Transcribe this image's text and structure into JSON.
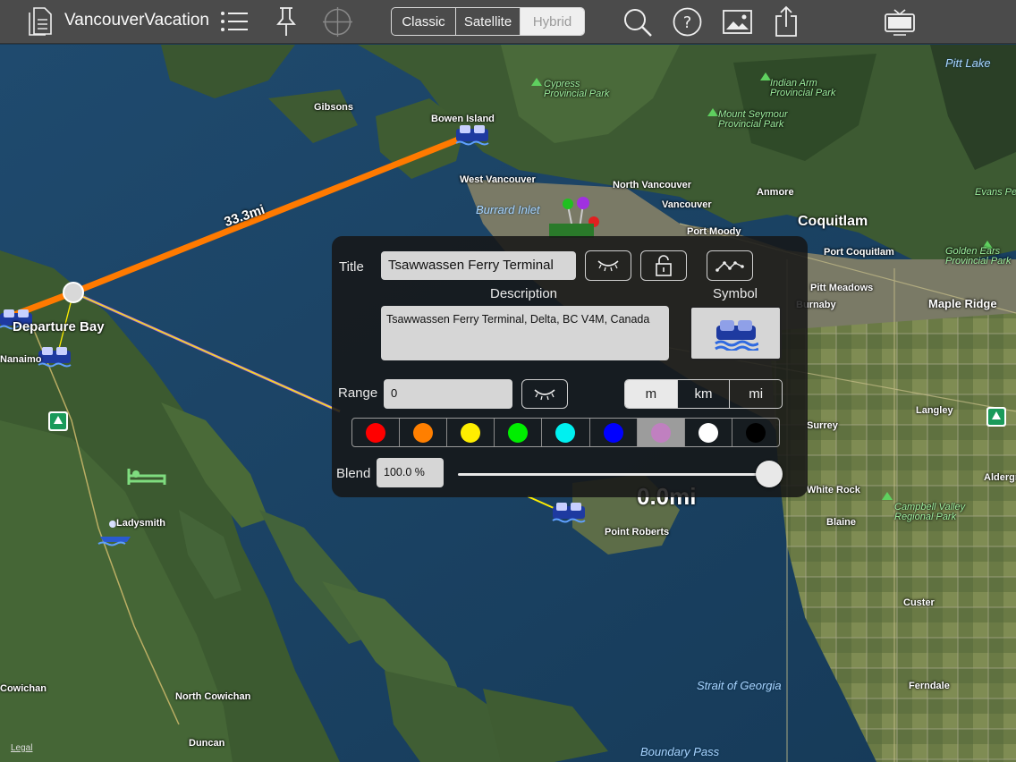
{
  "toolbar": {
    "title": "VancouverVacation",
    "map_types": [
      "Classic",
      "Satellite",
      "Hybrid"
    ],
    "selected_map_type": "Hybrid"
  },
  "map": {
    "distance_long": "33.3mi",
    "distance_short": "0.0mi",
    "legal": "Legal",
    "places": {
      "gibsons": "Gibsons",
      "bowen_island": "Bowen Island",
      "west_vancouver": "West Vancouver",
      "north_vancouver": "North Vancouver",
      "vancouver": "Vancouver",
      "port_moody": "Port Moody",
      "anmore": "Anmore",
      "coquitlam": "Coquitlam",
      "port_coquitlam": "Port Coquitlam",
      "pitt_meadows": "Pitt Meadows",
      "maple_ridge": "Maple Ridge",
      "langley": "Langley",
      "surrey": "Surrey",
      "white_rock": "White Rock",
      "blaine": "Blaine",
      "point_roberts": "Point Roberts",
      "custer": "Custer",
      "ferndale": "Ferndale",
      "departure_bay": "Departure Bay",
      "nanaimo": "Nanaimo",
      "ladysmith": "Ladysmith",
      "cowichan": "Cowichan",
      "north_cowichan": "North Cowichan",
      "duncan": "Duncan",
      "aldergrove": "Aldergrove",
      "burnaby": "Burnaby",
      "evans_peak": "Evans Pe"
    },
    "water": {
      "pitt_lake": "Pitt Lake",
      "burrard_inlet": "Burrard Inlet",
      "strait_of_georgia": "Strait of Georgia",
      "boundary_pass": "Boundary Pass"
    },
    "parks": {
      "cypress": [
        "Cypress",
        "Provincial Park"
      ],
      "indian_arm": [
        "Indian Arm",
        "Provincial Park"
      ],
      "mount_seymour": [
        "Mount Seymour",
        "Provincial Park"
      ],
      "golden_ears": [
        "Golden Ears",
        "Provincial Park"
      ],
      "campbell_valley": [
        "Campbell Valley",
        "Regional Park"
      ]
    }
  },
  "editor": {
    "title_label": "Title",
    "title_value": "Tsawwassen Ferry Terminal",
    "description_label": "Description",
    "description_value": "Tsawwassen Ferry Terminal, Delta, BC V4M, Canada",
    "symbol_label": "Symbol",
    "range_label": "Range",
    "range_value": "0",
    "units": [
      "m",
      "km",
      "mi"
    ],
    "selected_unit": "m",
    "blend_label": "Blend",
    "blend_value": "100.0 %",
    "blend_level": 1.0,
    "colors": [
      "#ff0000",
      "#ff7f00",
      "#ffee00",
      "#00ee00",
      "#00f0f0",
      "#0000ff",
      "#c080c0",
      "#ffffff",
      "#000000"
    ],
    "selected_color_index": 6
  }
}
